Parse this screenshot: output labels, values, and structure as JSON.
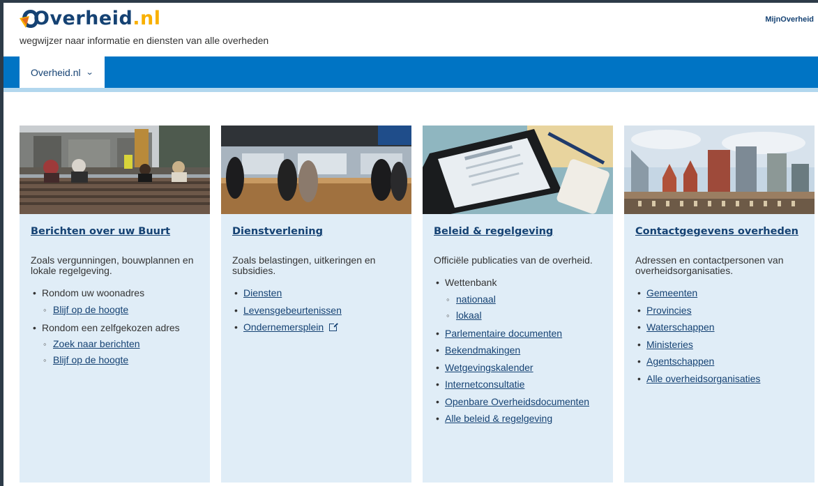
{
  "brand": {
    "name": "Overheid",
    "tld": ".nl",
    "tagline": "wegwijzer naar informatie en diensten van alle overheden",
    "account_link": "MijnOverheid"
  },
  "nav": {
    "tab_label": "Overheid.nl"
  },
  "cards": [
    {
      "title": "Berichten over uw Buurt",
      "image": "street-bench-photo",
      "description": "Zoals vergunningen, bouwplannen en lokale regelgeving.",
      "items": [
        {
          "label": "Rondom uw woonadres",
          "sub": [
            "Blijf op de hoogte"
          ]
        },
        {
          "label": "Rondom een zelfgekozen adres",
          "sub": [
            "Zoek naar berichten",
            "Blijf op de hoogte"
          ]
        }
      ]
    },
    {
      "title": "Dienstverlening",
      "image": "service-counter-photo",
      "description": "Zoals belastingen, uitkeringen en subsidies.",
      "items": [
        {
          "label": "Diensten"
        },
        {
          "label": "Levensgebeurtenissen"
        },
        {
          "label": "Ondernemersplein",
          "external": true
        }
      ]
    },
    {
      "title": "Beleid & regelgeving",
      "image": "tablet-document-photo",
      "description": "Officiële publicaties van de overheid.",
      "items": [
        {
          "label": "Wettenbank",
          "sub": [
            "nationaal",
            "lokaal"
          ]
        },
        {
          "label": "Parlementaire documenten"
        },
        {
          "label": "Bekendmakingen"
        },
        {
          "label": "Wetgevingskalender"
        },
        {
          "label": "Internetconsultatie"
        },
        {
          "label": "Openbare Overheidsdocumenten"
        },
        {
          "label": "Alle beleid & regelgeving"
        }
      ]
    },
    {
      "title": "Contactgegevens overheden",
      "image": "the-hague-skyline-photo",
      "description": "Adressen en contactpersonen van overheidsorganisaties.",
      "items": [
        {
          "label": "Gemeenten"
        },
        {
          "label": "Provincies"
        },
        {
          "label": "Waterschappen"
        },
        {
          "label": "Ministeries"
        },
        {
          "label": "Agentschappen"
        },
        {
          "label": "Alle overheidsorganisaties"
        }
      ]
    }
  ],
  "colors": {
    "brand_blue": "#154273",
    "nav_blue": "#0074c4",
    "card_bg": "#e0edf7",
    "accent": "#f9b000"
  }
}
